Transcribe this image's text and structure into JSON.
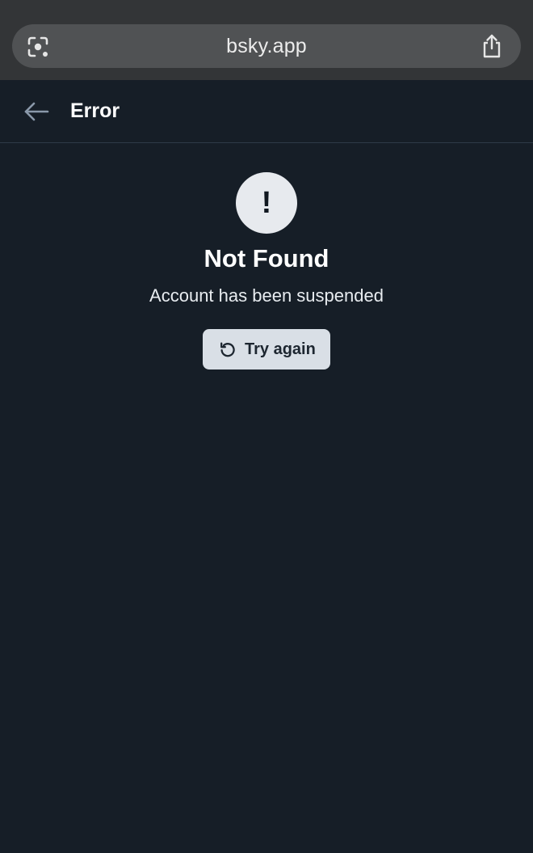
{
  "browser": {
    "url": "bsky.app",
    "left_icon": "lens-icon",
    "right_icon": "share-icon"
  },
  "header": {
    "title": "Error",
    "back_icon": "arrow-left-icon"
  },
  "error": {
    "icon_glyph": "!",
    "title": "Not Found",
    "message": "Account has been suspended"
  },
  "actions": {
    "retry_label": "Try again",
    "retry_icon": "refresh-icon"
  },
  "colors": {
    "background": "#161e27",
    "browser_bar": "#333537",
    "url_pill": "#505254",
    "button": "#d9dfe6",
    "circle": "#e7eaee"
  }
}
